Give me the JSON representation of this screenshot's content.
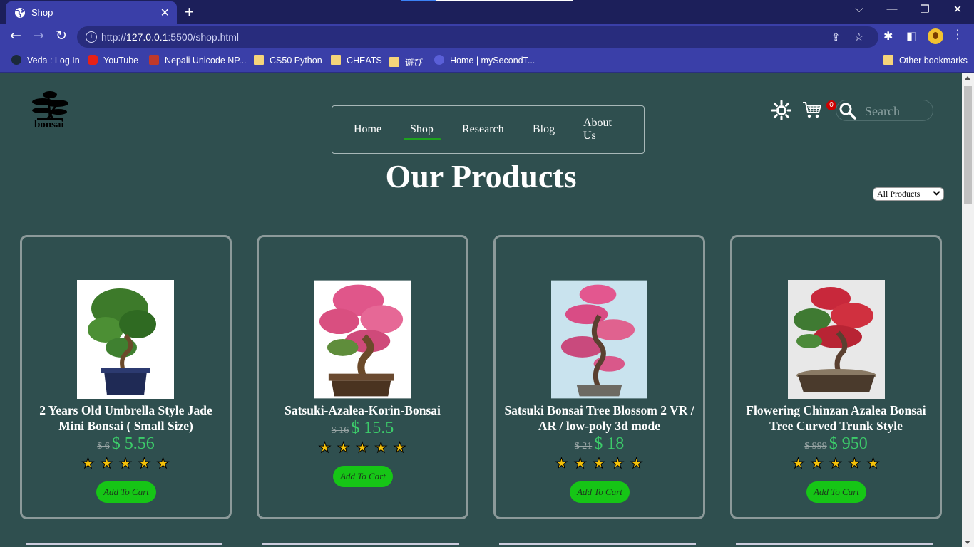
{
  "browser": {
    "tab_title": "Shop",
    "url_prefix": "http://",
    "url_host": "127.0.0.1",
    "url_rest": ":5500/shop.html",
    "bookmarks": [
      {
        "label": "Veda : Log In",
        "icon": "veda-icon"
      },
      {
        "label": "YouTube",
        "icon": "youtube-icon"
      },
      {
        "label": "Nepali Unicode NP...",
        "icon": "unicode-icon"
      },
      {
        "label": "CS50 Python",
        "icon": "folder-icon"
      },
      {
        "label": "CHEATS",
        "icon": "folder-icon"
      },
      {
        "label": "遊び",
        "icon": "folder-icon"
      },
      {
        "label": "Home | mySecondT...",
        "icon": "site-icon"
      }
    ],
    "other_bookmarks": "Other bookmarks"
  },
  "site": {
    "logo_text": "bonsai",
    "nav": [
      "Home",
      "Shop",
      "Research",
      "Blog",
      "About Us"
    ],
    "active_nav": "Shop",
    "cart_count": "0",
    "search_placeholder": "Search",
    "page_title": "Our Products",
    "filter_selected": "All Products",
    "colors": {
      "background": "#2f4f4f",
      "price_green": "#3ccc6a",
      "button_green": "#16c516",
      "star_yellow": "#f5c20a",
      "badge_red": "#cc0000"
    }
  },
  "products": [
    {
      "name": "2 Years Old Umbrella Style Jade Mini Bonsai ( Small Size)",
      "old_price": "$ 6",
      "price": "$ 5.56",
      "rating": 5,
      "button": "Add To Cart"
    },
    {
      "name": "Satsuki-Azalea-Korin-Bonsai",
      "old_price": "$ 16",
      "price": "$ 15.5",
      "rating": 5,
      "button": "Add To Cart"
    },
    {
      "name": "Satsuki Bonsai Tree Blossom 2 VR / AR / low-poly 3d mode",
      "old_price": "$ 21",
      "price": "$ 18",
      "rating": 5,
      "button": "Add To Cart"
    },
    {
      "name": "Flowering Chinzan Azalea Bonsai Tree Curved Trunk Style",
      "old_price": "$ 999",
      "price": "$ 950",
      "rating": 5,
      "button": "Add To Cart"
    }
  ]
}
